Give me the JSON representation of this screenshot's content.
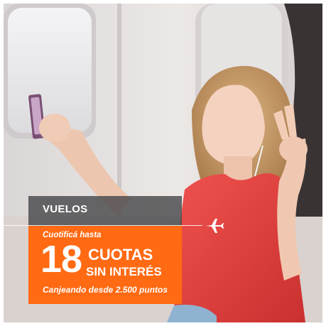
{
  "banner": {
    "category": "VUELOS",
    "promo_intro": "Cuotificá hasta",
    "promo_number": "18",
    "promo_line1": "CUOTAS",
    "promo_line2": "SIN INTERÉS",
    "promo_footer": "Canjeando desde 2.500 puntos"
  },
  "colors": {
    "accent_orange": "#ff6a13",
    "category_band": "#48484a",
    "text": "#ffffff"
  },
  "icons": {
    "plane": "airplane-icon"
  }
}
